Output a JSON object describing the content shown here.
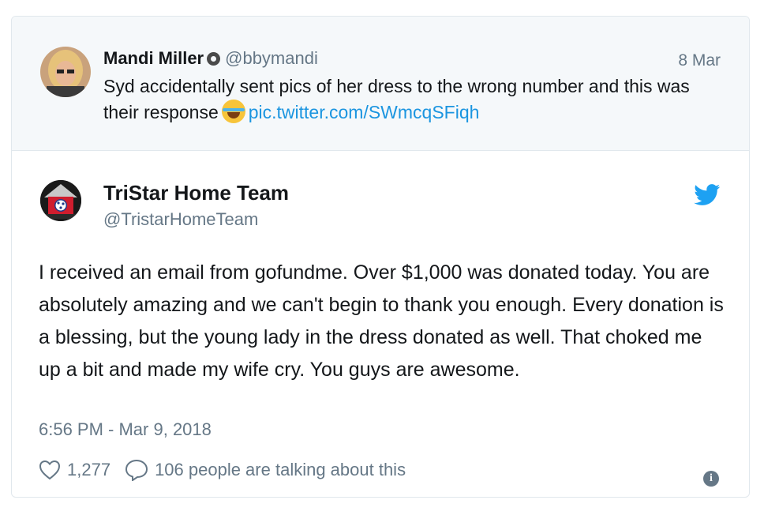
{
  "quoted": {
    "name": "Mandi Miller",
    "handle": "@bbymandi",
    "date": "8 Mar",
    "text_before": "Syd accidentally sent pics of her dress to the wrong number and this was their response",
    "link": "pic.twitter.com/SWmcqSFiqh"
  },
  "tweet": {
    "name": "TriStar Home Team",
    "handle": "@TristarHomeTeam",
    "text": "I received an email from gofundme. Over $1,000 was donated today. You are absolutely amazing and we can't begin to thank you enough. Every donation is a blessing, but the young lady in the dress donated as well. That choked me up a bit and made my wife cry. You guys are awesome.",
    "timestamp": "6:56 PM - Mar 9, 2018",
    "likes": "1,277",
    "replies_text": "106 people are talking about this",
    "info_glyph": "i"
  },
  "colors": {
    "link": "#1b95e0",
    "secondary_text": "#657786",
    "twitter_blue": "#1da1f2",
    "quote_bg": "#f5f8fa"
  }
}
